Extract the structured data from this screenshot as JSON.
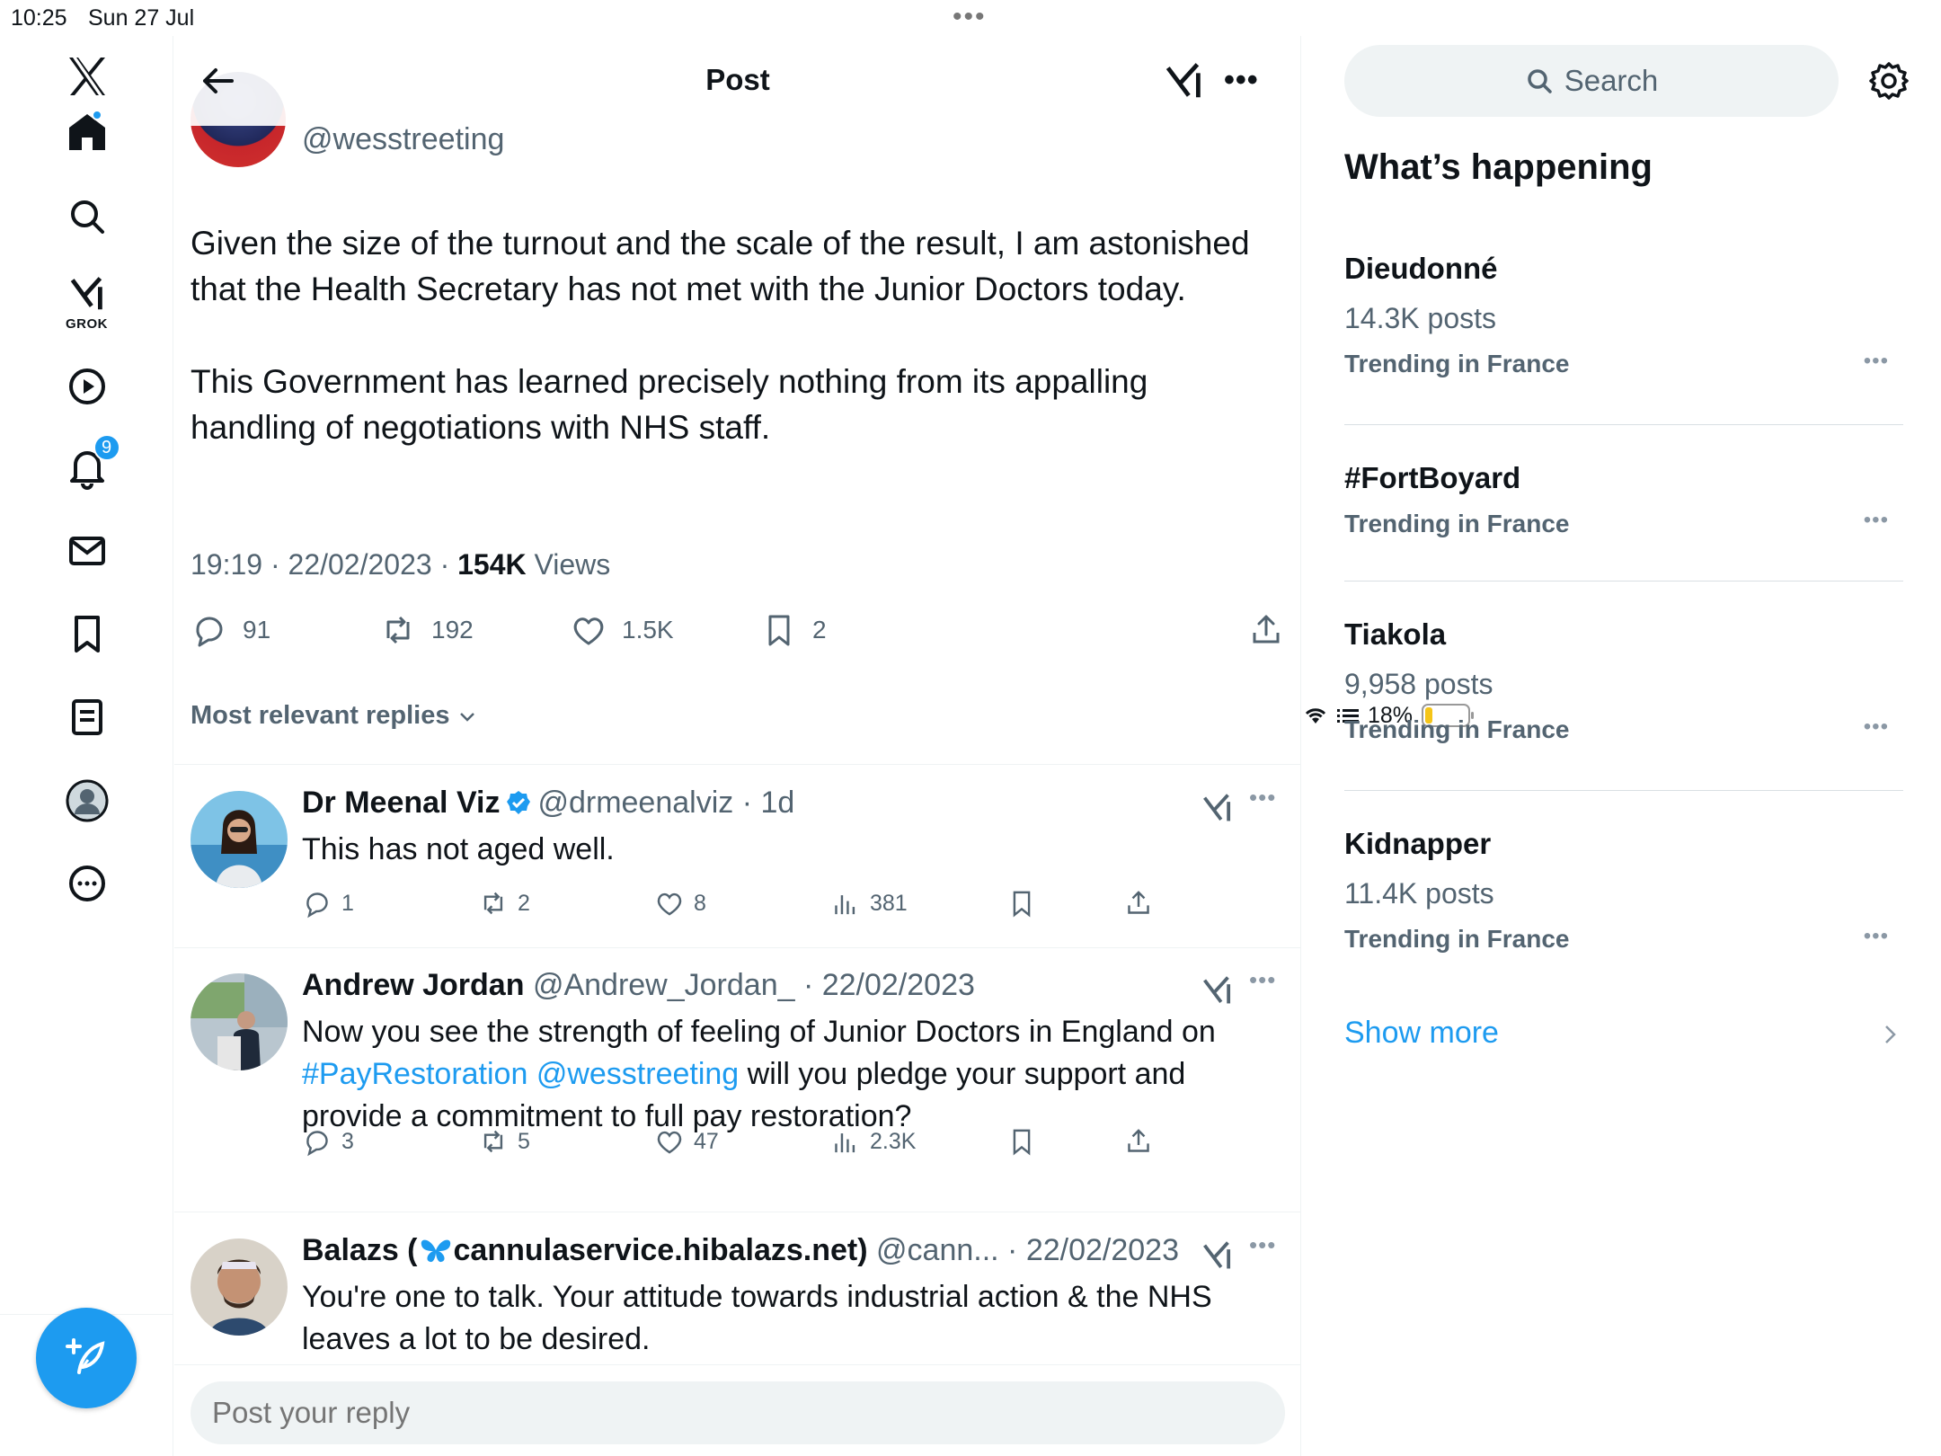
{
  "status_bar": {
    "time": "10:25",
    "date": "Sun 27 Jul",
    "battery": "18%"
  },
  "nav": {
    "grok_label": "GROK",
    "notifications_count": "9"
  },
  "header": {
    "title": "Post"
  },
  "post": {
    "handle": "@wesstreeting",
    "paragraph1": "Given the size of the turnout and the scale of the result, I am astonished that the Health Secretary has not met with the Junior Doctors today.",
    "paragraph2": "This Government has learned precisely nothing from its appalling handling of negotiations with NHS staff.",
    "time_date": "19:19 · 22/02/2023 · ",
    "views_count": "154K",
    "views_label": " Views",
    "replies": "91",
    "reposts": "192",
    "likes": "1.5K",
    "bookmarks": "2"
  },
  "sort_label": "Most relevant replies",
  "replies": [
    {
      "name": "Dr Meenal Viz",
      "handle": "@drmeenalviz · 1d",
      "text": "This has not aged well.",
      "replies": "1",
      "reposts": "2",
      "likes": "8",
      "views": "381"
    },
    {
      "name": "Andrew Jordan",
      "handle": "@Andrew_Jordan_ · 22/02/2023",
      "text_1": "Now you see the strength of feeling of Junior Doctors in England on ",
      "hashtag": "#PayRestoration",
      "mention": "@wesstreeting",
      "text_2": " will you pledge your support and provide a commitment to full pay restoration?",
      "replies": "3",
      "reposts": "5",
      "likes": "47",
      "views": "2.3K"
    },
    {
      "name_prefix": "Balazs (",
      "name_suffix": "cannulaservice.hibalazs.net)",
      "handle": "@cann... · 22/02/2023",
      "text": "You're one to talk. Your attitude towards industrial action & the NHS leaves a lot to be desired."
    }
  ],
  "reply_placeholder": "Post your reply",
  "sidebar": {
    "search_placeholder": "Search",
    "heading": "What’s happening",
    "trends": [
      {
        "name": "Dieudonné",
        "count": "14.3K posts",
        "location": "Trending in France"
      },
      {
        "name": "#FortBoyard",
        "location": "Trending in France"
      },
      {
        "name": "Tiakola",
        "count": "9,958 posts",
        "location": "Trending in France"
      },
      {
        "name": "Kidnapper",
        "count": "11.4K posts",
        "location": "Trending in France"
      }
    ],
    "show_more": "Show more"
  },
  "colors": {
    "accent": "#1d9bf0",
    "muted": "#536471",
    "text": "#0f1419",
    "bg_input": "#eff3f4"
  }
}
